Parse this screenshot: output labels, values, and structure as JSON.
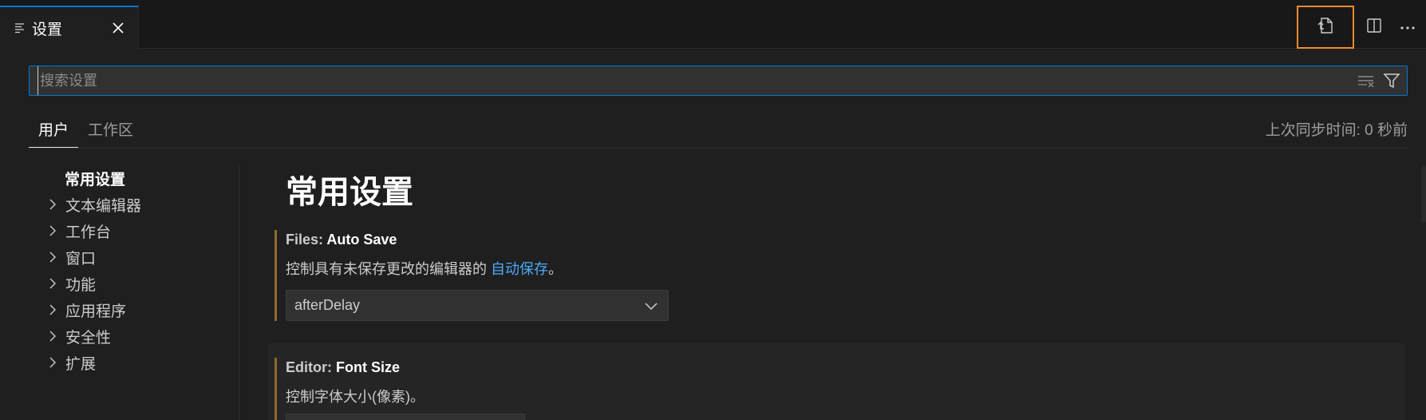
{
  "tab": {
    "title": "设置",
    "icon": "settings-list-icon",
    "close_icon": "close-icon"
  },
  "editor_actions": [
    {
      "name": "open-settings-json-icon",
      "highlighted": true
    },
    {
      "name": "split-editor-icon",
      "highlighted": false
    },
    {
      "name": "more-actions-icon",
      "highlighted": false
    }
  ],
  "search": {
    "placeholder": "搜索设置",
    "value": "",
    "clear_icon": "clear-filter-icon",
    "filter_icon": "filter-icon"
  },
  "scopes": {
    "user": "用户",
    "workspace": "工作区",
    "active": "user",
    "sync_status": "上次同步时间: 0 秒前"
  },
  "toc": {
    "active": "常用设置",
    "items": [
      "文本编辑器",
      "工作台",
      "窗口",
      "功能",
      "应用程序",
      "安全性",
      "扩展"
    ]
  },
  "content": {
    "section_title": "常用设置",
    "settings": [
      {
        "category": "Files: ",
        "name": "Auto Save",
        "description": "控制具有未保存更改的编辑器的 ",
        "description_link": "自动保存",
        "description_end": "。",
        "value": "afterDelay"
      },
      {
        "category": "Editor: ",
        "name": "Font Size",
        "description": "控制字体大小(像素)。"
      }
    ]
  },
  "colors": {
    "accent": "#0078d4",
    "highlight_border": "#f08a30",
    "link": "#4daafc",
    "modified_bar": "#8c6c2d"
  }
}
